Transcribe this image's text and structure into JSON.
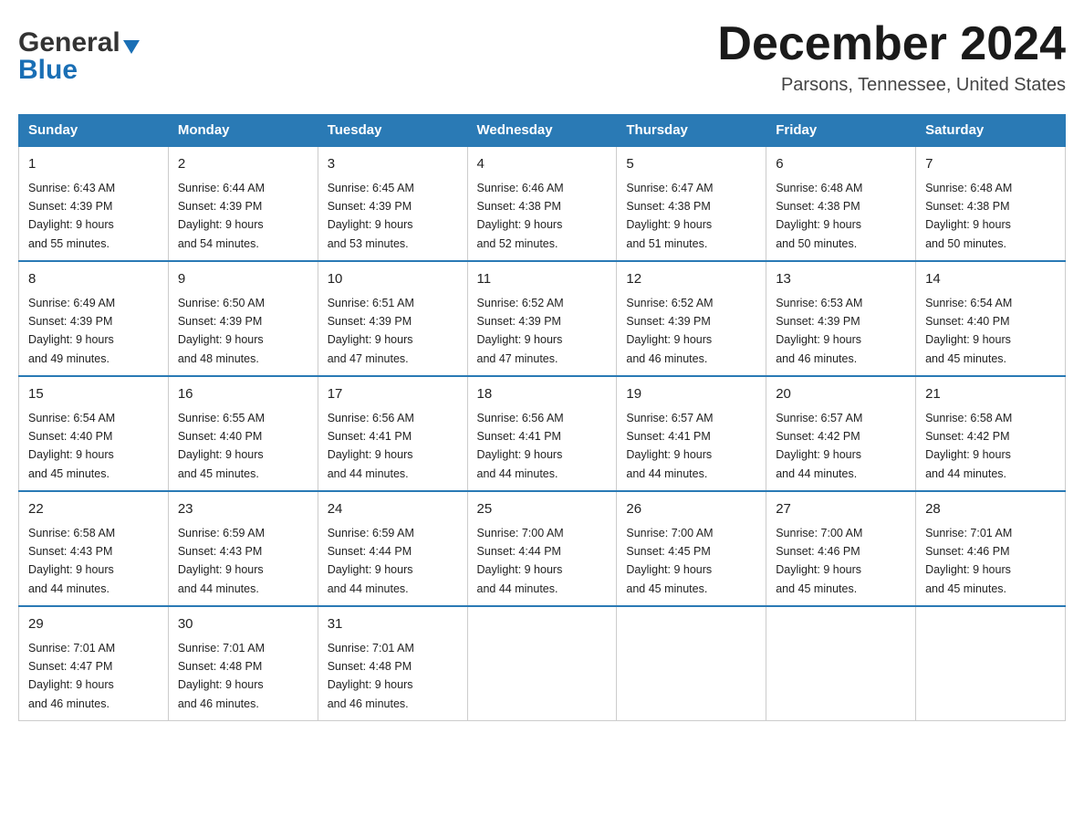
{
  "logo": {
    "general": "General",
    "blue": "Blue",
    "triangle": "▶"
  },
  "title": "December 2024",
  "location": "Parsons, Tennessee, United States",
  "days_of_week": [
    "Sunday",
    "Monday",
    "Tuesday",
    "Wednesday",
    "Thursday",
    "Friday",
    "Saturday"
  ],
  "weeks": [
    [
      {
        "day": "1",
        "sunrise": "6:43 AM",
        "sunset": "4:39 PM",
        "daylight": "9 hours and 55 minutes."
      },
      {
        "day": "2",
        "sunrise": "6:44 AM",
        "sunset": "4:39 PM",
        "daylight": "9 hours and 54 minutes."
      },
      {
        "day": "3",
        "sunrise": "6:45 AM",
        "sunset": "4:39 PM",
        "daylight": "9 hours and 53 minutes."
      },
      {
        "day": "4",
        "sunrise": "6:46 AM",
        "sunset": "4:38 PM",
        "daylight": "9 hours and 52 minutes."
      },
      {
        "day": "5",
        "sunrise": "6:47 AM",
        "sunset": "4:38 PM",
        "daylight": "9 hours and 51 minutes."
      },
      {
        "day": "6",
        "sunrise": "6:48 AM",
        "sunset": "4:38 PM",
        "daylight": "9 hours and 50 minutes."
      },
      {
        "day": "7",
        "sunrise": "6:48 AM",
        "sunset": "4:38 PM",
        "daylight": "9 hours and 50 minutes."
      }
    ],
    [
      {
        "day": "8",
        "sunrise": "6:49 AM",
        "sunset": "4:39 PM",
        "daylight": "9 hours and 49 minutes."
      },
      {
        "day": "9",
        "sunrise": "6:50 AM",
        "sunset": "4:39 PM",
        "daylight": "9 hours and 48 minutes."
      },
      {
        "day": "10",
        "sunrise": "6:51 AM",
        "sunset": "4:39 PM",
        "daylight": "9 hours and 47 minutes."
      },
      {
        "day": "11",
        "sunrise": "6:52 AM",
        "sunset": "4:39 PM",
        "daylight": "9 hours and 47 minutes."
      },
      {
        "day": "12",
        "sunrise": "6:52 AM",
        "sunset": "4:39 PM",
        "daylight": "9 hours and 46 minutes."
      },
      {
        "day": "13",
        "sunrise": "6:53 AM",
        "sunset": "4:39 PM",
        "daylight": "9 hours and 46 minutes."
      },
      {
        "day": "14",
        "sunrise": "6:54 AM",
        "sunset": "4:40 PM",
        "daylight": "9 hours and 45 minutes."
      }
    ],
    [
      {
        "day": "15",
        "sunrise": "6:54 AM",
        "sunset": "4:40 PM",
        "daylight": "9 hours and 45 minutes."
      },
      {
        "day": "16",
        "sunrise": "6:55 AM",
        "sunset": "4:40 PM",
        "daylight": "9 hours and 45 minutes."
      },
      {
        "day": "17",
        "sunrise": "6:56 AM",
        "sunset": "4:41 PM",
        "daylight": "9 hours and 44 minutes."
      },
      {
        "day": "18",
        "sunrise": "6:56 AM",
        "sunset": "4:41 PM",
        "daylight": "9 hours and 44 minutes."
      },
      {
        "day": "19",
        "sunrise": "6:57 AM",
        "sunset": "4:41 PM",
        "daylight": "9 hours and 44 minutes."
      },
      {
        "day": "20",
        "sunrise": "6:57 AM",
        "sunset": "4:42 PM",
        "daylight": "9 hours and 44 minutes."
      },
      {
        "day": "21",
        "sunrise": "6:58 AM",
        "sunset": "4:42 PM",
        "daylight": "9 hours and 44 minutes."
      }
    ],
    [
      {
        "day": "22",
        "sunrise": "6:58 AM",
        "sunset": "4:43 PM",
        "daylight": "9 hours and 44 minutes."
      },
      {
        "day": "23",
        "sunrise": "6:59 AM",
        "sunset": "4:43 PM",
        "daylight": "9 hours and 44 minutes."
      },
      {
        "day": "24",
        "sunrise": "6:59 AM",
        "sunset": "4:44 PM",
        "daylight": "9 hours and 44 minutes."
      },
      {
        "day": "25",
        "sunrise": "7:00 AM",
        "sunset": "4:44 PM",
        "daylight": "9 hours and 44 minutes."
      },
      {
        "day": "26",
        "sunrise": "7:00 AM",
        "sunset": "4:45 PM",
        "daylight": "9 hours and 45 minutes."
      },
      {
        "day": "27",
        "sunrise": "7:00 AM",
        "sunset": "4:46 PM",
        "daylight": "9 hours and 45 minutes."
      },
      {
        "day": "28",
        "sunrise": "7:01 AM",
        "sunset": "4:46 PM",
        "daylight": "9 hours and 45 minutes."
      }
    ],
    [
      {
        "day": "29",
        "sunrise": "7:01 AM",
        "sunset": "4:47 PM",
        "daylight": "9 hours and 46 minutes."
      },
      {
        "day": "30",
        "sunrise": "7:01 AM",
        "sunset": "4:48 PM",
        "daylight": "9 hours and 46 minutes."
      },
      {
        "day": "31",
        "sunrise": "7:01 AM",
        "sunset": "4:48 PM",
        "daylight": "9 hours and 46 minutes."
      },
      null,
      null,
      null,
      null
    ]
  ]
}
